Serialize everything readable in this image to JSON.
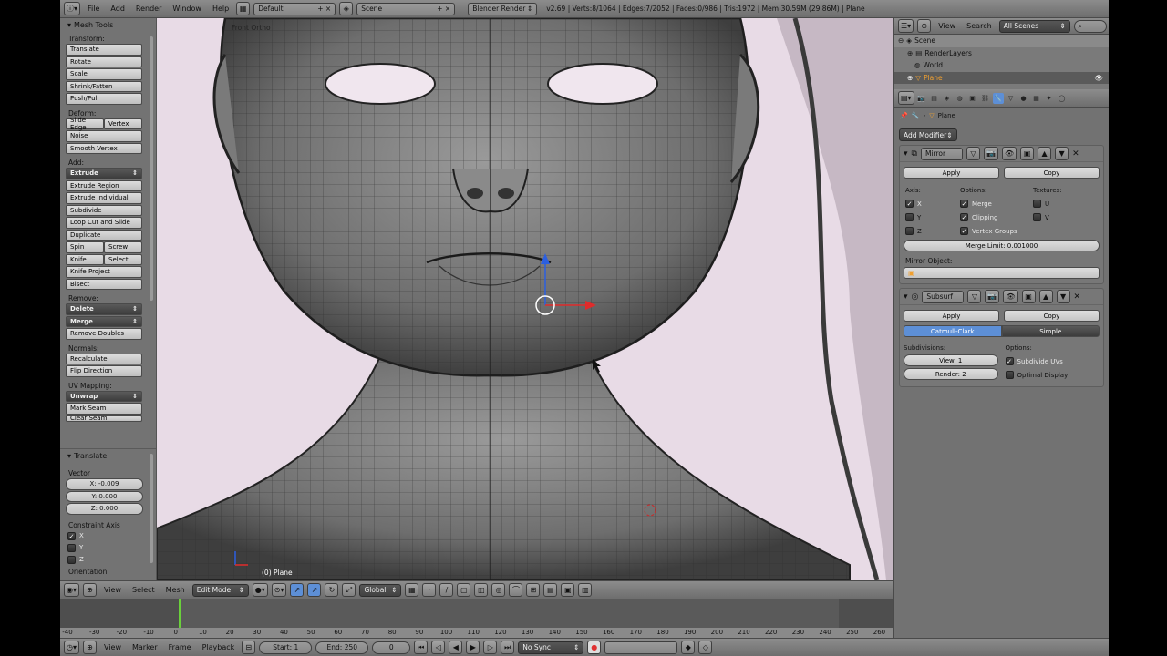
{
  "topbar": {
    "menus": [
      "File",
      "Add",
      "Render",
      "Window",
      "Help"
    ],
    "screen_layout": "Default",
    "scene": "Scene",
    "render_engine": "Blender Render",
    "stats": "v2.69 | Verts:8/1064 | Edges:7/2052 | Faces:0/986 | Tris:1972 | Mem:30.59M (29.86M) | Plane"
  },
  "toolshelf": {
    "title": "Mesh Tools",
    "transform_label": "Transform:",
    "translate": "Translate",
    "rotate": "Rotate",
    "scale": "Scale",
    "shrink_fatten": "Shrink/Fatten",
    "push_pull": "Push/Pull",
    "deform_label": "Deform:",
    "slide_edge": "Slide Edge",
    "vertex": "Vertex",
    "noise": "Noise",
    "smooth_vertex": "Smooth Vertex",
    "add_label": "Add:",
    "extrude": "Extrude",
    "extrude_region": "Extrude Region",
    "extrude_individual": "Extrude Individual",
    "subdivide": "Subdivide",
    "loop_cut": "Loop Cut and Slide",
    "duplicate": "Duplicate",
    "spin": "Spin",
    "screw": "Screw",
    "knife": "Knife",
    "select": "Select",
    "knife_project": "Knife Project",
    "bisect": "Bisect",
    "remove_label": "Remove:",
    "delete": "Delete",
    "merge": "Merge",
    "remove_doubles": "Remove Doubles",
    "normals_label": "Normals:",
    "recalculate": "Recalculate",
    "flip_direction": "Flip Direction",
    "uv_label": "UV Mapping:",
    "unwrap": "Unwrap",
    "mark_seam": "Mark Seam",
    "clear_seam": "Clear Seam",
    "operator_title": "Translate",
    "vector_label": "Vector",
    "x_val": "X: -0.009",
    "y_val": "Y: 0.000",
    "z_val": "Z: 0.000",
    "constraint_label": "Constraint Axis",
    "cx": "X",
    "cy": "Y",
    "cz": "Z",
    "orientation_label": "Orientation"
  },
  "viewport": {
    "view_name": "Front Ortho",
    "object_label": "(0) Plane"
  },
  "vpheader": {
    "view": "View",
    "select": "Select",
    "mesh": "Mesh",
    "mode": "Edit Mode",
    "orientation": "Global"
  },
  "timeline": {
    "ticks": [
      "-40",
      "-30",
      "-20",
      "-10",
      "0",
      "10",
      "20",
      "30",
      "40",
      "50",
      "60",
      "70",
      "80",
      "90",
      "100",
      "110",
      "120",
      "130",
      "140",
      "150",
      "160",
      "170",
      "180",
      "190",
      "200",
      "210",
      "220",
      "230",
      "240",
      "250",
      "260"
    ],
    "current_frame": 0
  },
  "bottombar": {
    "view": "View",
    "marker": "Marker",
    "frame": "Frame",
    "playback": "Playback",
    "start": "Start: 1",
    "end": "End: 250",
    "current": "0",
    "sync": "No Sync"
  },
  "outliner": {
    "view": "View",
    "search": "Search",
    "scope": "All Scenes",
    "items": [
      "Scene",
      "RenderLayers",
      "World",
      "Plane"
    ]
  },
  "properties": {
    "breadcrumb": "Plane",
    "add_modifier": "Add Modifier",
    "mirror": {
      "name": "Mirror",
      "apply": "Apply",
      "copy": "Copy",
      "axis_label": "Axis:",
      "options_label": "Options:",
      "textures_label": "Textures:",
      "x": "X",
      "y": "Y",
      "z": "Z",
      "merge": "Merge",
      "clipping": "Clipping",
      "vertex_groups": "Vertex Groups",
      "u": "U",
      "v": "V",
      "merge_limit": "Merge Limit: 0.001000",
      "mirror_object_label": "Mirror Object:"
    },
    "subsurf": {
      "name": "Subsurf",
      "apply": "Apply",
      "copy": "Copy",
      "catmull": "Catmull-Clark",
      "simple": "Simple",
      "subdivisions_label": "Subdivisions:",
      "options_label": "Options:",
      "view": "View: 1",
      "render": "Render: 2",
      "subdivide_uvs": "Subdivide UVs",
      "optimal_display": "Optimal Display"
    }
  },
  "colors": {
    "viewport_bg": "#e8dbe6",
    "active_blue": "#5d8fd6",
    "frame_marker": "#6ad03b"
  }
}
